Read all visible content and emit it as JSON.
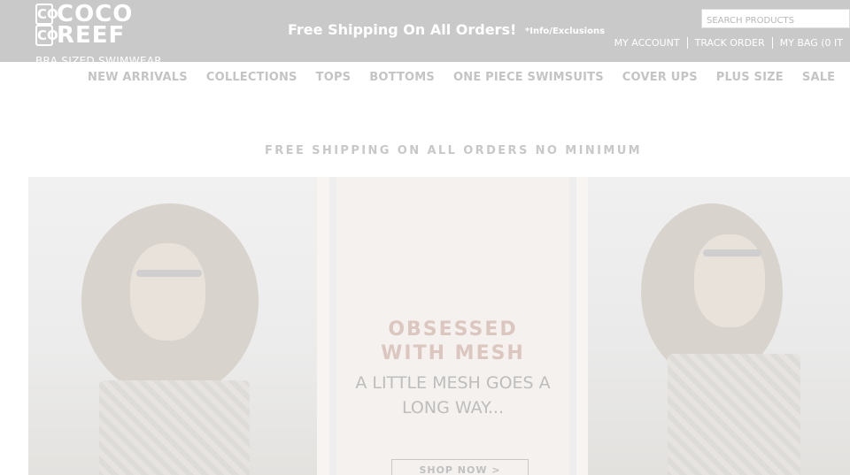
{
  "brand": {
    "logo_line1": "COCO",
    "logo_line2": "REEF",
    "tagline": "BRA SIZED SWIMWEAR",
    "logo_initials_top": "CO",
    "logo_initials_bottom": "CO"
  },
  "promo": {
    "headline": "Free Shipping On All Orders!",
    "link": "*Info/Exclusions"
  },
  "search": {
    "placeholder": "SEARCH PRODUCTS"
  },
  "account_links": [
    "MY ACCOUNT",
    "TRACK ORDER",
    "MY BAG (0 IT"
  ],
  "nav": [
    "NEW ARRIVALS",
    "COLLECTIONS",
    "TOPS",
    "BOTTOMS",
    "ONE PIECE SWIMSUITS",
    "COVER UPS",
    "PLUS SIZE",
    "SALE"
  ],
  "banner_text": "FREE SHIPPING ON ALL ORDERS NO MINIMUM",
  "hero": {
    "title_line1": "OBSESSED",
    "title_line2": "WITH MESH",
    "subtitle_line1": "A LITTLE MESH GOES A",
    "subtitle_line2": "LONG WAY...",
    "cta": "SHOP NOW >"
  },
  "colors": {
    "topbar": "#c9c9c9",
    "nav_text": "#c4c4c4",
    "hero_title": "#dcc6c0"
  }
}
